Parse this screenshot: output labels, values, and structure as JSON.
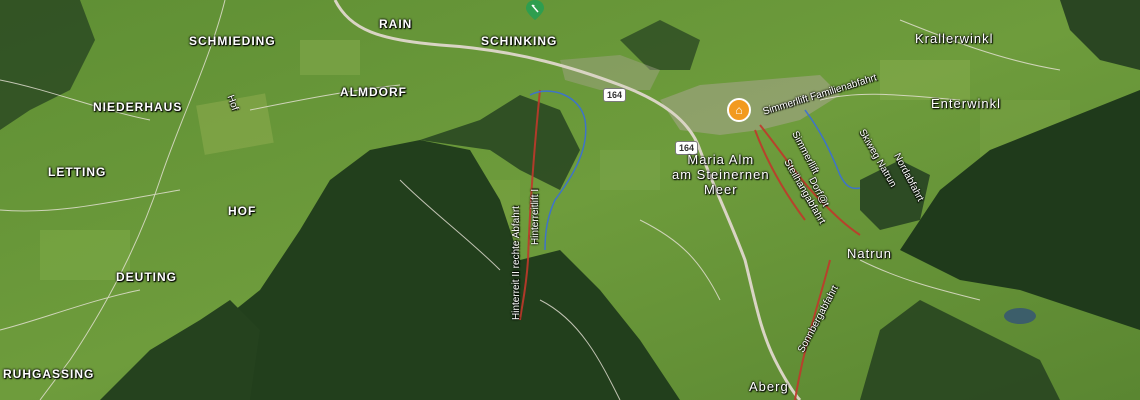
{
  "map": {
    "place_labels": {
      "rain": "RAIN",
      "schinking": "SCHINKING",
      "schmieding": "SCHMIEDING",
      "niederhaus": "NIEDERHAUS",
      "almdorf": "ALMDORF",
      "letting": "LETTING",
      "hof": "HOF",
      "deuting": "DEUTING",
      "ruhgassing": "RUHGASSING",
      "krallerwinkl": "Krallerwinkl",
      "enterwinkl": "Enterwinkl",
      "maria_alm_line1": "Maria Alm",
      "maria_alm_line2": "am Steinernen",
      "maria_alm_line3": "Meer",
      "natrun": "Natrun",
      "aberg": "Aberg"
    },
    "road_shields": {
      "road_164_a": "164",
      "road_164_b": "164"
    },
    "piste_labels": {
      "hinterreit_rechte_abfahrt": "Hinterreit II rechte Abfahrt",
      "hinterreitlift": "Hinterreitlift I",
      "simmerllift_familienabfahrt": "Simmerllift Familienabfahrt",
      "simmerllift": "Simmerllift",
      "dorfjet": "Dorf@t",
      "steilhangabfahrt": "Steilhangabfahrt",
      "skiweg_natrun": "Skiweg Natrun",
      "nordabfahrt": "Nordabfahrt",
      "sonnbergabfahrt": "Sonnbergabfahrt",
      "hof_road": "Hof"
    },
    "markers": {
      "home_icon": "home-icon",
      "poi_icon": "ski-lift-poi-icon"
    },
    "colors": {
      "pasture": "#6a9a3a",
      "forest": "#22401c",
      "piste_red": "#c0392b",
      "piste_blue": "#3a6fd8",
      "road": "#d9d4c4",
      "home_marker": "#f29a1f",
      "poi_marker": "#2e9e4f"
    }
  }
}
